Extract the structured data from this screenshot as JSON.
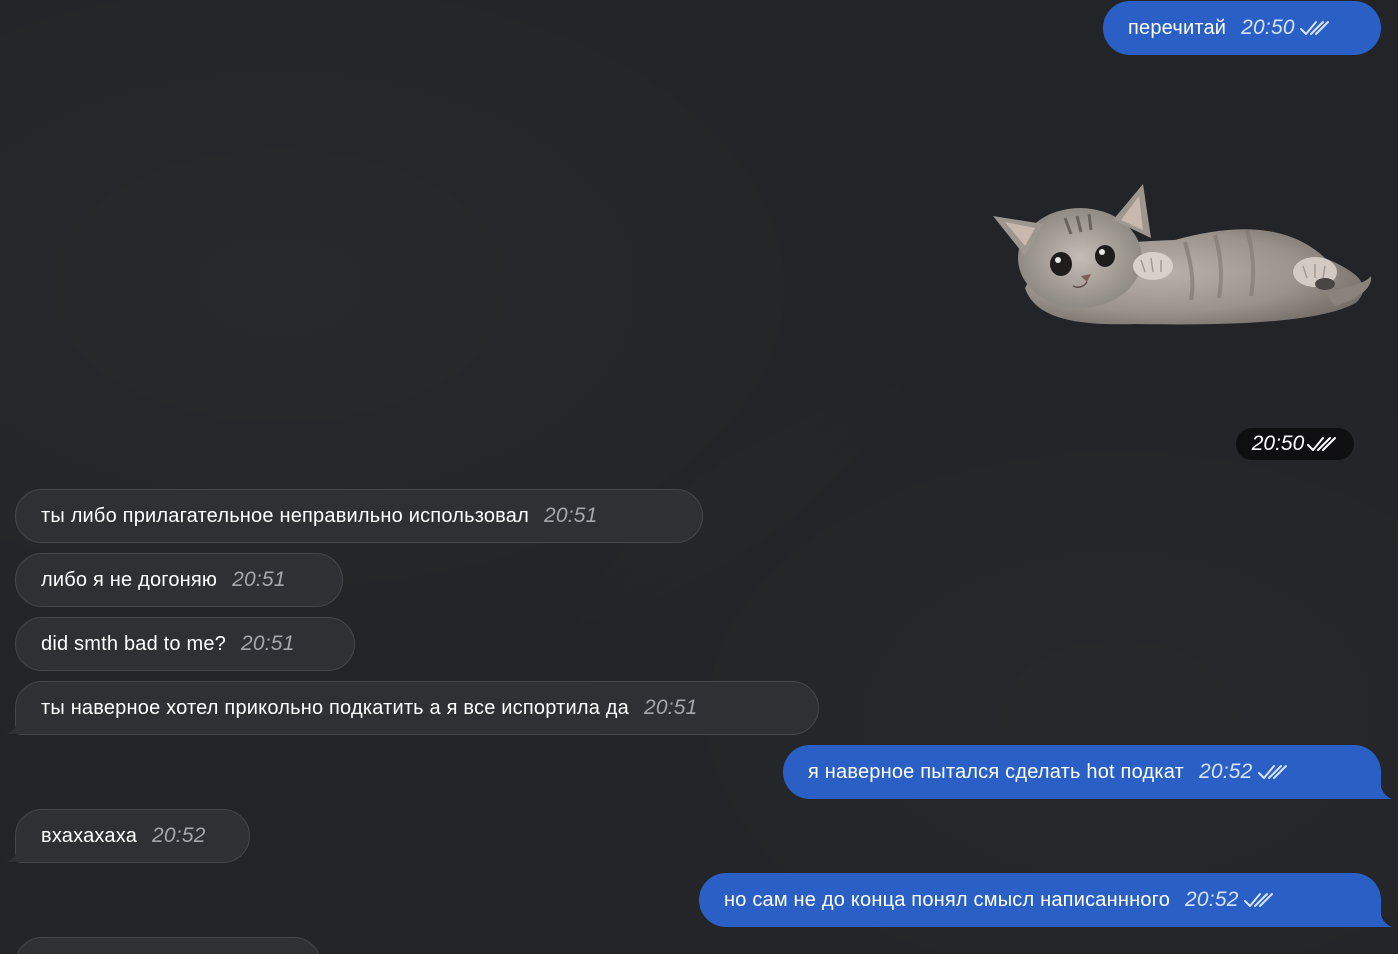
{
  "messages": [
    {
      "id": "m1",
      "direction": "outgoing",
      "text": "перечитай",
      "time": "20:50",
      "status": "read"
    },
    {
      "id": "m2",
      "direction": "outgoing",
      "type": "sticker",
      "sticker_icon": "kitten-sticker-icon",
      "time": "20:50",
      "status": "read"
    },
    {
      "id": "m3",
      "direction": "incoming",
      "text": "ты либо прилагательное неправильно использовал",
      "time": "20:51"
    },
    {
      "id": "m4",
      "direction": "incoming",
      "text": "либо я не догоняю",
      "time": "20:51"
    },
    {
      "id": "m5",
      "direction": "incoming",
      "text": "did smth bad to me?",
      "time": "20:51"
    },
    {
      "id": "m6",
      "direction": "incoming",
      "text": "ты наверное хотел прикольно подкатить а я все испортила да",
      "time": "20:51"
    },
    {
      "id": "m7",
      "direction": "outgoing",
      "text": "я наверное пытался сделать hot подкат",
      "time": "20:52",
      "status": "read"
    },
    {
      "id": "m8",
      "direction": "incoming",
      "text": "вхахахаха",
      "time": "20:52"
    },
    {
      "id": "m9",
      "direction": "outgoing",
      "text": "но сам не до конца понял смысл написанннoго",
      "time": "20:52",
      "status": "read"
    }
  ],
  "colors": {
    "background": "#222427",
    "incoming_bubble": "#2e3033",
    "incoming_border": "#44474b",
    "outgoing_bubble": "#2a60c6",
    "time_incoming": "#a3a7ad",
    "time_outgoing": "#d7e3fb"
  },
  "icons": {
    "read_status": "double-check-icon"
  }
}
